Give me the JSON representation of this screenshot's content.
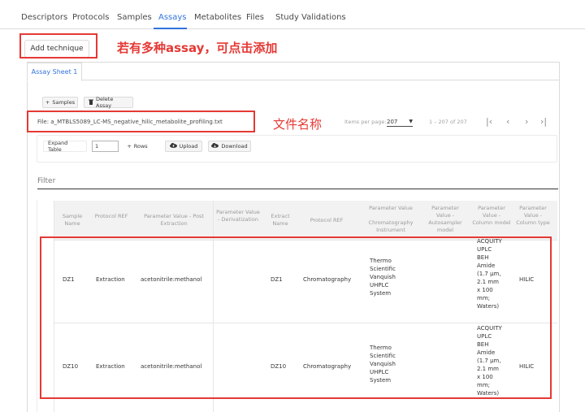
{
  "tabs": [
    {
      "label": "Descriptors",
      "active": false
    },
    {
      "label": "Protocols",
      "active": false
    },
    {
      "label": "Samples",
      "active": false
    },
    {
      "label": "Assays",
      "active": true
    },
    {
      "label": "Metabolites",
      "active": false
    },
    {
      "label": "Files",
      "active": false
    },
    {
      "label": "Study Validations",
      "active": false
    }
  ],
  "add_technique_label": "Add technique",
  "annotation_top": "若有多种assay，可点击添加",
  "annotation_file": "文件名称",
  "sheet_tab": "Assay Sheet 1",
  "actions": {
    "samples_label": "Samples",
    "delete_assay_label": "Delete Assay"
  },
  "file_label": "File: a_MTBLS5089_LC-MS_negative_hilic_metabolite_profiling.txt",
  "pager": {
    "items_per_page_label": "Items per page:",
    "items_per_page_value": "207",
    "range_label": "1 – 207 of 207"
  },
  "toolbar": {
    "expand_label": "Expand Table",
    "rows_value": "1",
    "rows_label": "Rows",
    "upload_label": "Upload",
    "download_label": "Download"
  },
  "filter_label": "Filter",
  "table": {
    "headers": [
      "Sample Name",
      "Protocol REF",
      "Parameter Value - Post Extraction",
      "Parameter Value - Derivatization",
      "Extract Name",
      "Protocol REF",
      "Parameter Value\n\nChromatography Instrument",
      "Parameter Value - Autosampler model",
      "Parameter Value - Column model",
      "Parameter Value - Column type"
    ],
    "rows": [
      {
        "sample_name": "DZ1",
        "protocol_ref": "Extraction",
        "post_extraction": "acetonitrile:methanol",
        "derivatization": "",
        "extract_name": "DZ1",
        "protocol_ref2": "Chromatography",
        "instrument": "Thermo\nScientific\nVanquish\nUHPLC\nSystem",
        "autosampler": "",
        "column_model": "ACQUITY\nUPLC\nBEH\nAmide\n(1.7 μm,\n2.1 mm\nx 100\nmm;\nWaters)",
        "column_type": "HILIC"
      },
      {
        "sample_name": "DZ10",
        "protocol_ref": "Extraction",
        "post_extraction": "acetonitrile:methanol",
        "derivatization": "",
        "extract_name": "DZ10",
        "protocol_ref2": "Chromatography",
        "instrument": "Thermo\nScientific\nVanquish\nUHPLC\nSystem",
        "autosampler": "",
        "column_model": "ACQUITY\nUPLC\nBEH\nAmide\n(1.7 μm,\n2.1 mm\nx 100\nmm;\nWaters)",
        "column_type": "HILIC"
      }
    ]
  },
  "colors": {
    "accent": "#3273dc",
    "annotation": "#e53935"
  }
}
